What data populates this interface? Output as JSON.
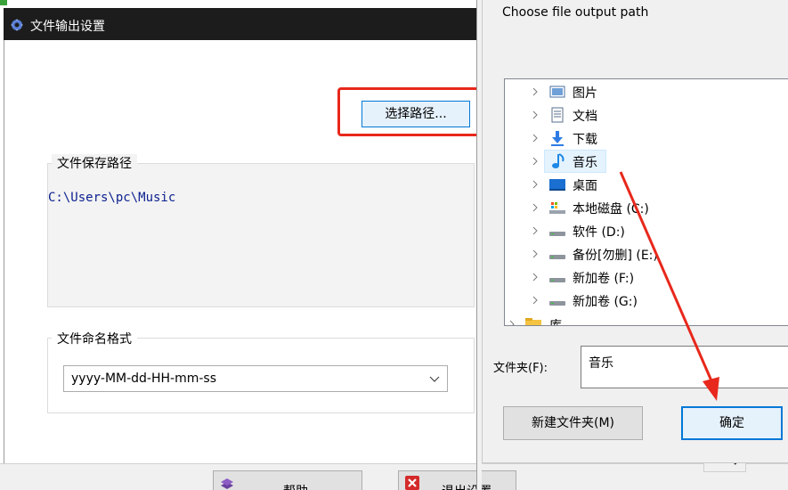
{
  "settings_window": {
    "title": "文件输出设置",
    "select_path_button": "选择路径...",
    "save_path_group": "文件保存路径",
    "save_path_value": "C:\\Users\\pc\\Music",
    "naming_group": "文件命名格式",
    "naming_format": "yyyy-MM-dd-HH-mm-ss",
    "help_button": "帮助",
    "exit_button": "退出设置"
  },
  "dialog": {
    "title": "Choose file output path",
    "tree": [
      {
        "label": "图片",
        "icon": "pictures-icon"
      },
      {
        "label": "文档",
        "icon": "documents-icon"
      },
      {
        "label": "下载",
        "icon": "downloads-icon"
      },
      {
        "label": "音乐",
        "icon": "music-icon",
        "selected": true
      },
      {
        "label": "桌面",
        "icon": "desktop-icon"
      },
      {
        "label": "本地磁盘 (C:)",
        "icon": "system-drive-icon"
      },
      {
        "label": "软件 (D:)",
        "icon": "drive-icon"
      },
      {
        "label": "备份[勿删] (E:)",
        "icon": "drive-icon"
      },
      {
        "label": "新加卷 (F:)",
        "icon": "drive-icon"
      },
      {
        "label": "新加卷 (G:)",
        "icon": "drive-icon"
      },
      {
        "label": "库",
        "icon": "library-icon"
      }
    ],
    "folder_label": "文件夹(F):",
    "folder_value": "音乐",
    "new_folder_button": "新建文件夹(M)",
    "ok_button": "确定"
  },
  "colors": {
    "highlight": "#e8281c",
    "accent": "#0078d7",
    "path_text": "#0b1f8f"
  }
}
